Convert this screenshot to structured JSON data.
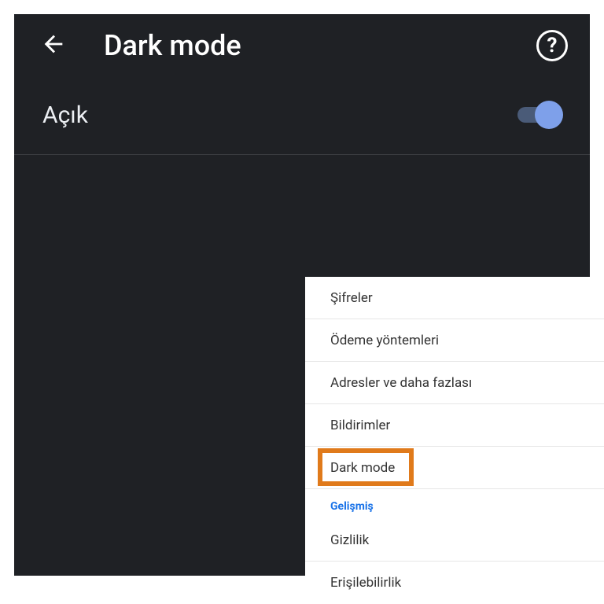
{
  "header": {
    "title": "Dark mode",
    "help_glyph": "?"
  },
  "toggle": {
    "label": "Açık",
    "state": "on"
  },
  "menu": {
    "items": [
      {
        "label": "Şifreler"
      },
      {
        "label": "Ödeme yöntemleri"
      },
      {
        "label": "Adresler ve daha fazlası"
      },
      {
        "label": "Bildirimler"
      },
      {
        "label": "Dark mode",
        "highlighted": true
      }
    ],
    "section_heading": "Gelişmiş",
    "section_items": [
      {
        "label": "Gizlilik"
      },
      {
        "label": "Erişilebilirlik"
      }
    ]
  },
  "colors": {
    "dark_bg": "#1f2125",
    "accent_switch": "#7ea0ea",
    "highlight_border": "#e07a1b",
    "section_heading": "#1a73e8"
  }
}
